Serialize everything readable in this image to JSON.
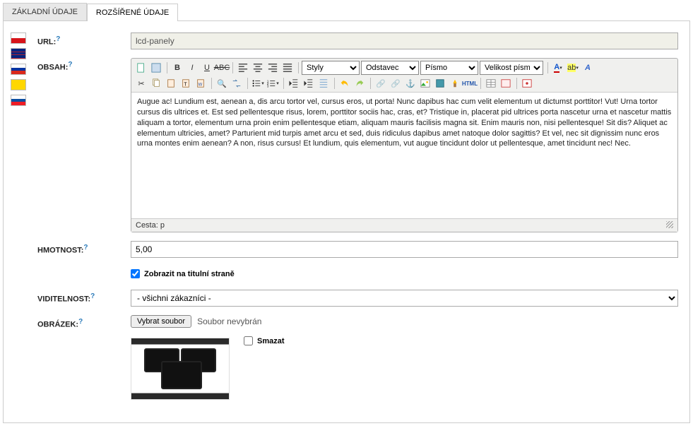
{
  "tabs": {
    "basic": "ZÁKLADNÍ ÚDAJE",
    "extended": "ROZŠÍŘENÉ ÚDAJE"
  },
  "labels": {
    "url": "URL:",
    "obsah": "OBSAH:",
    "hmotnost": "HMOTNOST:",
    "viditelnost": "VIDITELNOST:",
    "obrazek": "OBRÁZEK:"
  },
  "url_value": "lcd-panely",
  "editor": {
    "styles": "Styly",
    "paragraph": "Odstavec",
    "font": "Písmo",
    "fontsize": "Velikost písma",
    "html_btn": "HTML",
    "content": "Augue ac! Lundium est, aenean a, dis arcu tortor vel, cursus eros, ut porta! Nunc dapibus hac cum velit elementum ut dictumst porttitor! Vut! Urna tortor cursus dis ultrices et. Est sed pellentesque risus, lorem, porttitor sociis hac, cras, et? Tristique in, placerat pid ultrices porta nascetur urna et nascetur mattis aliquam a tortor, elementum urna proin enim pellentesque etiam, aliquam mauris facilisis magna sit. Enim mauris non, nisi pellentesque! Sit dis? Aliquet ac elementum ultricies, amet? Parturient mid turpis amet arcu et sed, duis ridiculus dapibus amet natoque dolor sagittis? Et vel, nec sit dignissim nunc eros urna montes enim aenean? A non, risus cursus! Et lundium, quis elementum, vut augue tincidunt dolor ut pellentesque, amet tincidunt nec! Nec.",
    "status": "Cesta: p"
  },
  "hmotnost_value": "5,00",
  "zobrazit": {
    "label": "Zobrazit na titulní straně",
    "checked": true
  },
  "viditelnost_value": "- všichni zákazníci -",
  "file": {
    "button": "Vybrat soubor",
    "status": "Soubor nevybrán"
  },
  "smazat": {
    "label": "Smazat",
    "checked": false
  }
}
